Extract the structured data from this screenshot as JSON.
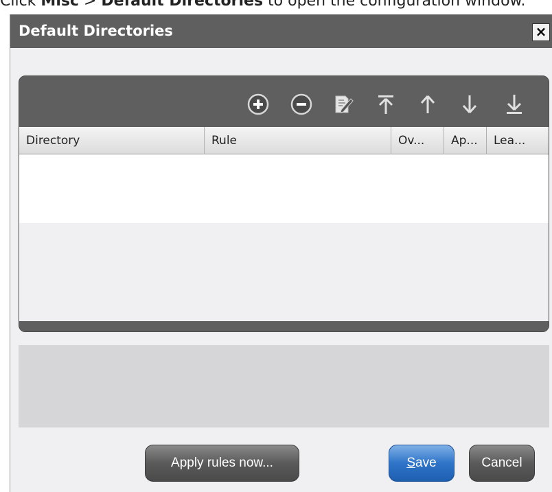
{
  "caption": {
    "prefix": "Click ",
    "menu": "Misc",
    "separator": " > ",
    "item": "Default Directories",
    "suffix": " to open the configuration window."
  },
  "dialog": {
    "title": "Default Directories",
    "close_label": "×"
  },
  "toolbar": {
    "icons": [
      "add-icon",
      "remove-icon",
      "edit-icon",
      "move-top-icon",
      "move-up-icon",
      "move-down-icon",
      "move-bottom-icon"
    ]
  },
  "table": {
    "columns": [
      "Directory",
      "Rule",
      "Ov...",
      "Ap...",
      "Lea..."
    ],
    "rows": []
  },
  "buttons": {
    "apply_label": "Apply rules now...",
    "save_mnemonic": "S",
    "save_rest": "ave",
    "cancel_label": "Cancel"
  },
  "colors": {
    "titlebar": "#5f5f5f",
    "primary_button": "#2e74c8",
    "dark_button": "#5a5a5a"
  }
}
